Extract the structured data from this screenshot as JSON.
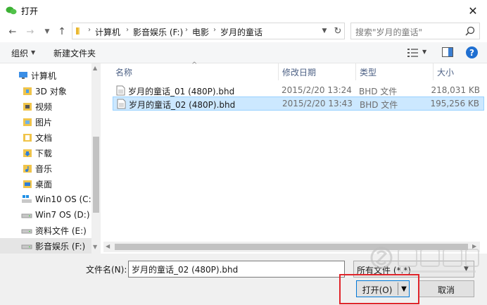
{
  "window": {
    "title": "打开"
  },
  "address": {
    "crumbs": [
      "计算机",
      "影音娱乐 (F:)",
      "电影",
      "岁月的童话"
    ]
  },
  "search": {
    "placeholder": "搜索\"岁月的童话\""
  },
  "toolbar": {
    "organize": "组织",
    "new_folder": "新建文件夹"
  },
  "nav": {
    "items": [
      {
        "label": "计算机",
        "icon": "computer-icon"
      },
      {
        "label": "3D 对象",
        "icon": "folder-3d-icon"
      },
      {
        "label": "视频",
        "icon": "folder-video-icon"
      },
      {
        "label": "图片",
        "icon": "folder-pictures-icon"
      },
      {
        "label": "文档",
        "icon": "folder-documents-icon"
      },
      {
        "label": "下载",
        "icon": "folder-downloads-icon"
      },
      {
        "label": "音乐",
        "icon": "folder-music-icon"
      },
      {
        "label": "桌面",
        "icon": "folder-desktop-icon"
      },
      {
        "label": "Win10 OS (C:)",
        "icon": "windows-drive-icon"
      },
      {
        "label": "Win7 OS (D:)",
        "icon": "drive-icon"
      },
      {
        "label": "资料文件 (E:)",
        "icon": "drive-icon"
      },
      {
        "label": "影音娱乐 (F:)",
        "icon": "drive-icon"
      }
    ]
  },
  "file_list": {
    "columns": {
      "name": "名称",
      "modified": "修改日期",
      "type": "类型",
      "size": "大小"
    },
    "rows": [
      {
        "name": "岁月的童话_01 (480P).bhd",
        "modified": "2015/2/20 13:24",
        "type": "BHD 文件",
        "size": "218,031 KB"
      },
      {
        "name": "岁月的童话_02 (480P).bhd",
        "modified": "2015/2/20 13:43",
        "type": "BHD 文件",
        "size": "195,256 KB"
      }
    ]
  },
  "bottom": {
    "filename_label": "文件名(N):",
    "filename_value": "岁月的童话_02 (480P).bhd",
    "filetype": "所有文件 (*.*)",
    "open": "打开(O)",
    "cancel": "取消"
  },
  "colors": {
    "selection": "#cce8ff",
    "accent": "#0078d7",
    "highlight_box": "#e0242a"
  }
}
